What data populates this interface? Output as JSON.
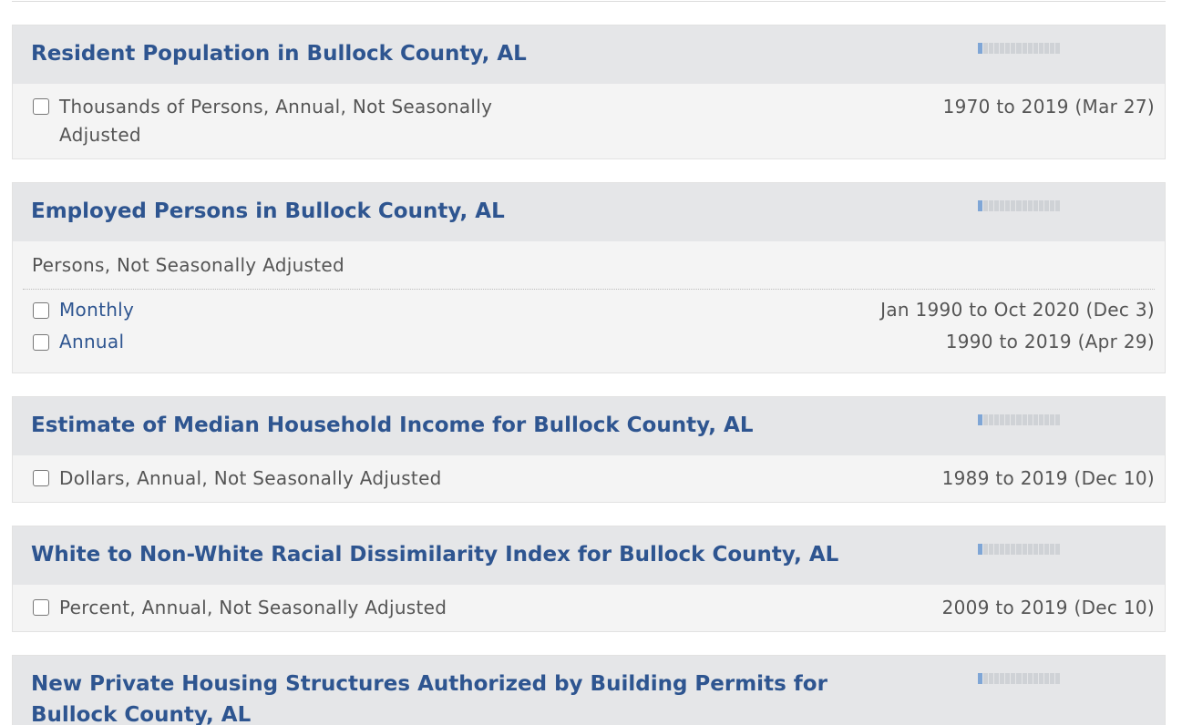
{
  "series": [
    {
      "title": "Resident Population in Bullock County, AL",
      "popularity_fraction": 0.06,
      "units": "Thousands of Persons, Annual, Not Seasonally Adjusted",
      "range": "1970 to 2019 (Mar 27)"
    },
    {
      "title": "Employed Persons in Bullock County, AL",
      "popularity_fraction": 0.06,
      "units_header": "Persons, Not Seasonally Adjusted",
      "frequencies": [
        {
          "label": "Monthly",
          "range": "Jan 1990 to Oct 2020 (Dec 3)"
        },
        {
          "label": "Annual",
          "range": "1990 to 2019 (Apr 29)"
        }
      ]
    },
    {
      "title": "Estimate of Median Household Income for Bullock County, AL",
      "popularity_fraction": 0.06,
      "units": "Dollars, Annual, Not Seasonally Adjusted",
      "range": "1989 to 2019 (Dec 10)"
    },
    {
      "title": "White to Non-White Racial Dissimilarity Index for Bullock County, AL",
      "popularity_fraction": 0.06,
      "units": "Percent, Annual, Not Seasonally Adjusted",
      "range": "2009 to 2019 (Dec 10)"
    },
    {
      "title": "New Private Housing Structures Authorized by Building Permits for Bullock County, AL",
      "popularity_fraction": 0.06
    }
  ],
  "colors": {
    "title": "#2e5590",
    "header_bg": "#e5e6e8",
    "body_bg": "#f4f4f4",
    "popularity_on": "#7fa6d6",
    "popularity_off": "#cfd2d6"
  }
}
